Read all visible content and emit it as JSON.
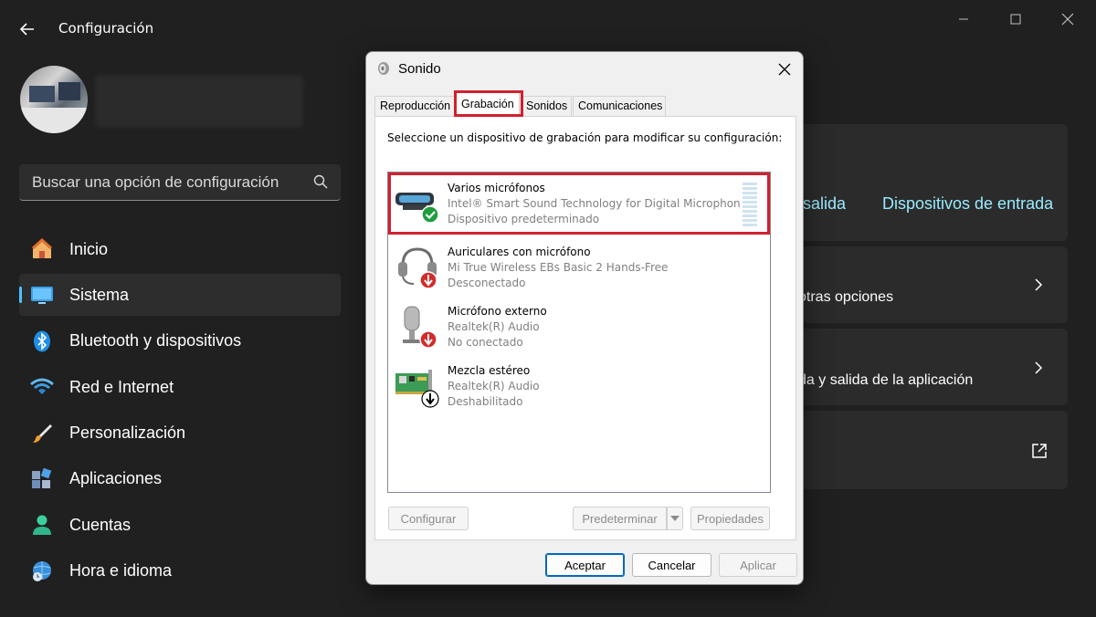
{
  "window": {
    "title": "Configuración"
  },
  "search": {
    "placeholder": "Buscar una opción de configuración"
  },
  "sidebar": {
    "items": [
      {
        "label": "Inicio",
        "icon": "home-icon",
        "active": false
      },
      {
        "label": "Sistema",
        "icon": "system-icon",
        "active": true
      },
      {
        "label": "Bluetooth y dispositivos",
        "icon": "bluetooth-icon",
        "active": false
      },
      {
        "label": "Red e Internet",
        "icon": "wifi-icon",
        "active": false
      },
      {
        "label": "Personalización",
        "icon": "brush-icon",
        "active": false
      },
      {
        "label": "Aplicaciones",
        "icon": "apps-icon",
        "active": false
      },
      {
        "label": "Cuentas",
        "icon": "account-icon",
        "active": false
      },
      {
        "label": "Hora e idioma",
        "icon": "time-language-icon",
        "active": false
      }
    ]
  },
  "main": {
    "link_output": "salida",
    "link_input": "Dispositivos de entrada",
    "row1_text": "otras opciones",
    "row2_text": "da y salida de la aplicación"
  },
  "dialog": {
    "title": "Sonido",
    "tabs": [
      "Reproducción",
      "Grabación",
      "Sonidos",
      "Comunicaciones"
    ],
    "active_tab": "Grabación",
    "instruction": "Seleccione un dispositivo de grabación para modificar su configuración:",
    "devices": [
      {
        "name": "Varios micrófonos",
        "detail": "Intel® Smart Sound Technology for Digital Microphon...",
        "status": "Dispositivo predeterminado",
        "icon": "mic-array-icon",
        "badge": "check-badge-icon",
        "selected": true
      },
      {
        "name": "Auriculares con micrófono",
        "detail": "Mi True Wireless EBs Basic 2 Hands-Free",
        "status": "Desconectado",
        "icon": "headset-icon",
        "badge": "red-down-arrow-badge-icon",
        "selected": false
      },
      {
        "name": "Micrófono externo",
        "detail": "Realtek(R) Audio",
        "status": "No conectado",
        "icon": "external-mic-icon",
        "badge": "red-down-arrow-badge-icon",
        "selected": false
      },
      {
        "name": "Mezcla estéreo",
        "detail": "Realtek(R) Audio",
        "status": "Deshabilitado",
        "icon": "sound-card-icon",
        "badge": "black-down-arrow-badge-icon",
        "selected": false
      }
    ],
    "buttons": {
      "configure": "Configurar",
      "set_default": "Predeterminar",
      "properties": "Propiedades",
      "ok": "Aceptar",
      "cancel": "Cancelar",
      "apply": "Aplicar"
    }
  },
  "colors": {
    "background": "#202020",
    "accent": "#4cc2ff",
    "link": "#99ebff",
    "highlight": "#d1202e"
  }
}
